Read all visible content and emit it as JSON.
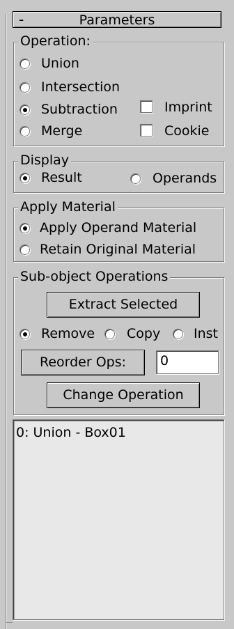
{
  "rollout": {
    "collapse_symbol": "-",
    "title": "Parameters"
  },
  "operation": {
    "title": "Operation:",
    "options": [
      "Union",
      "Intersection",
      "Subtraction",
      "Merge"
    ],
    "selected": "Subtraction",
    "imprint_label": "Imprint",
    "imprint_checked": false,
    "cookie_label": "Cookie",
    "cookie_checked": false
  },
  "display": {
    "title": "Display",
    "options": [
      "Result",
      "Operands"
    ],
    "selected": "Result"
  },
  "apply_material": {
    "title": "Apply Material",
    "options": [
      "Apply Operand Material",
      "Retain Original Material"
    ],
    "selected": "Apply Operand Material"
  },
  "subobject": {
    "title": "Sub-object Operations",
    "extract_label": "Extract Selected",
    "modes": [
      "Remove",
      "Copy",
      "Inst"
    ],
    "selected_mode": "Remove",
    "reorder_label": "Reorder Ops:",
    "reorder_value": "0",
    "change_label": "Change Operation"
  },
  "operations_list": {
    "items": [
      "0: Union - Box01"
    ]
  }
}
